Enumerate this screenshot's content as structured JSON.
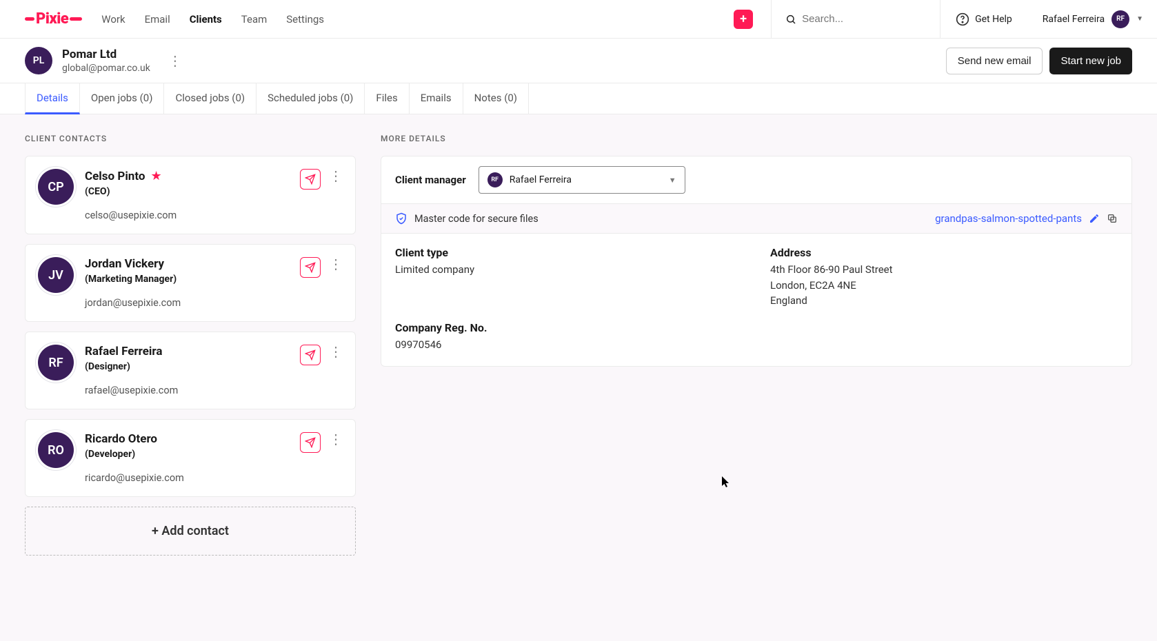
{
  "brand": "Pixie",
  "nav": {
    "work": "Work",
    "email": "Email",
    "clients": "Clients",
    "team": "Team",
    "settings": "Settings"
  },
  "search": {
    "placeholder": "Search..."
  },
  "help": {
    "label": "Get Help"
  },
  "user": {
    "name": "Rafael Ferreira",
    "initials": "RF"
  },
  "client": {
    "avatar_initials": "PL",
    "name": "Pomar Ltd",
    "email": "global@pomar.co.uk"
  },
  "actions": {
    "send_email": "Send new email",
    "start_job": "Start new job"
  },
  "tabs": {
    "details": "Details",
    "open_jobs": "Open jobs (0)",
    "closed_jobs": "Closed jobs (0)",
    "scheduled_jobs": "Scheduled jobs (0)",
    "files": "Files",
    "emails": "Emails",
    "notes": "Notes (0)"
  },
  "sections": {
    "contacts_label": "CLIENT CONTACTS",
    "more_label": "MORE DETAILS"
  },
  "contacts": [
    {
      "initials": "CP",
      "name": "Celso Pinto",
      "role": "(CEO)",
      "email": "celso@usepixie.com",
      "starred": true
    },
    {
      "initials": "JV",
      "name": "Jordan Vickery",
      "role": "(Marketing Manager)",
      "email": "jordan@usepixie.com",
      "starred": false
    },
    {
      "initials": "RF",
      "name": "Rafael Ferreira",
      "role": "(Designer)",
      "email": "rafael@usepixie.com",
      "starred": false
    },
    {
      "initials": "RO",
      "name": "Ricardo Otero",
      "role": "(Developer)",
      "email": "ricardo@usepixie.com",
      "starred": false
    }
  ],
  "add_contact_label": "+ Add contact",
  "manager": {
    "label": "Client manager",
    "value": "Rafael Ferreira",
    "initials": "RF"
  },
  "mastercode": {
    "label": "Master code for secure files",
    "value": "grandpas-salmon-spotted-pants"
  },
  "details": {
    "client_type_label": "Client type",
    "client_type_value": "Limited company",
    "address_label": "Address",
    "address_line1": "4th Floor 86-90 Paul Street",
    "address_line2": "London, EC2A 4NE",
    "address_line3": "England",
    "reg_label": "Company Reg. No.",
    "reg_value": "09970546"
  }
}
